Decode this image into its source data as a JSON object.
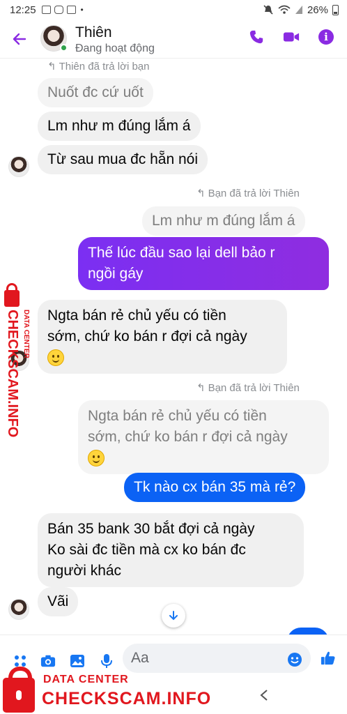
{
  "status_bar": {
    "time": "12:25",
    "dot": "•",
    "battery": "26%"
  },
  "header": {
    "contact_name": "Thiên",
    "status": "Đang hoạt động"
  },
  "messages": [
    {
      "type": "reply_note",
      "text": "Thiên đã trả lời bạn"
    },
    {
      "type": "quoted_in",
      "text": "Nuốt đc cứ  uốt"
    },
    {
      "type": "in",
      "text": "Lm như m đúng lắm á"
    },
    {
      "type": "in",
      "text": "Từ sau mua đc hẵn nói"
    },
    {
      "type": "reply_note",
      "text": "Bạn đã trả lời Thiên"
    },
    {
      "type": "quoted_out",
      "text": "Lm như m đúng lắm á"
    },
    {
      "type": "out",
      "lines": [
        "Thế lúc đầu sao lại dell bảo r",
        "ngồi gáy"
      ]
    },
    {
      "type": "in",
      "lines": [
        "Ngta bán rẻ chủ yếu có tiền",
        "sớm, chứ ko bán r đợi cả ngày"
      ]
    },
    {
      "type": "reply_note",
      "text": "Bạn đã trả lời Thiên"
    },
    {
      "type": "quoted_out",
      "lines": [
        "Ngta bán rẻ chủ yếu có tiền",
        "sớm, chứ ko bán r đợi cả ngày"
      ]
    },
    {
      "type": "out",
      "text": "Tk nào cx bán 35 mà rẻ?"
    },
    {
      "type": "in",
      "lines": [
        "Bán 35 bank 30 bắt đợi cả ngày",
        "Ko sài đc tiền mà cx ko bán đc",
        "người khác"
      ]
    },
    {
      "type": "in",
      "text": "Vãi"
    }
  ],
  "composer": {
    "placeholder": "Aa"
  },
  "watermark": {
    "line1": "DATA CENTER",
    "line2": "CHECKSCAM.INFO"
  },
  "colors": {
    "accent": "#8a2be2",
    "blue": "#0b62f5",
    "watermark": "#e1171e"
  },
  "icons": [
    "back-arrow-icon",
    "phone-icon",
    "video-icon",
    "info-icon",
    "menu-dots-icon",
    "camera-icon",
    "gallery-icon",
    "mic-icon",
    "emoji-icon",
    "like-icon",
    "scroll-down-icon"
  ]
}
